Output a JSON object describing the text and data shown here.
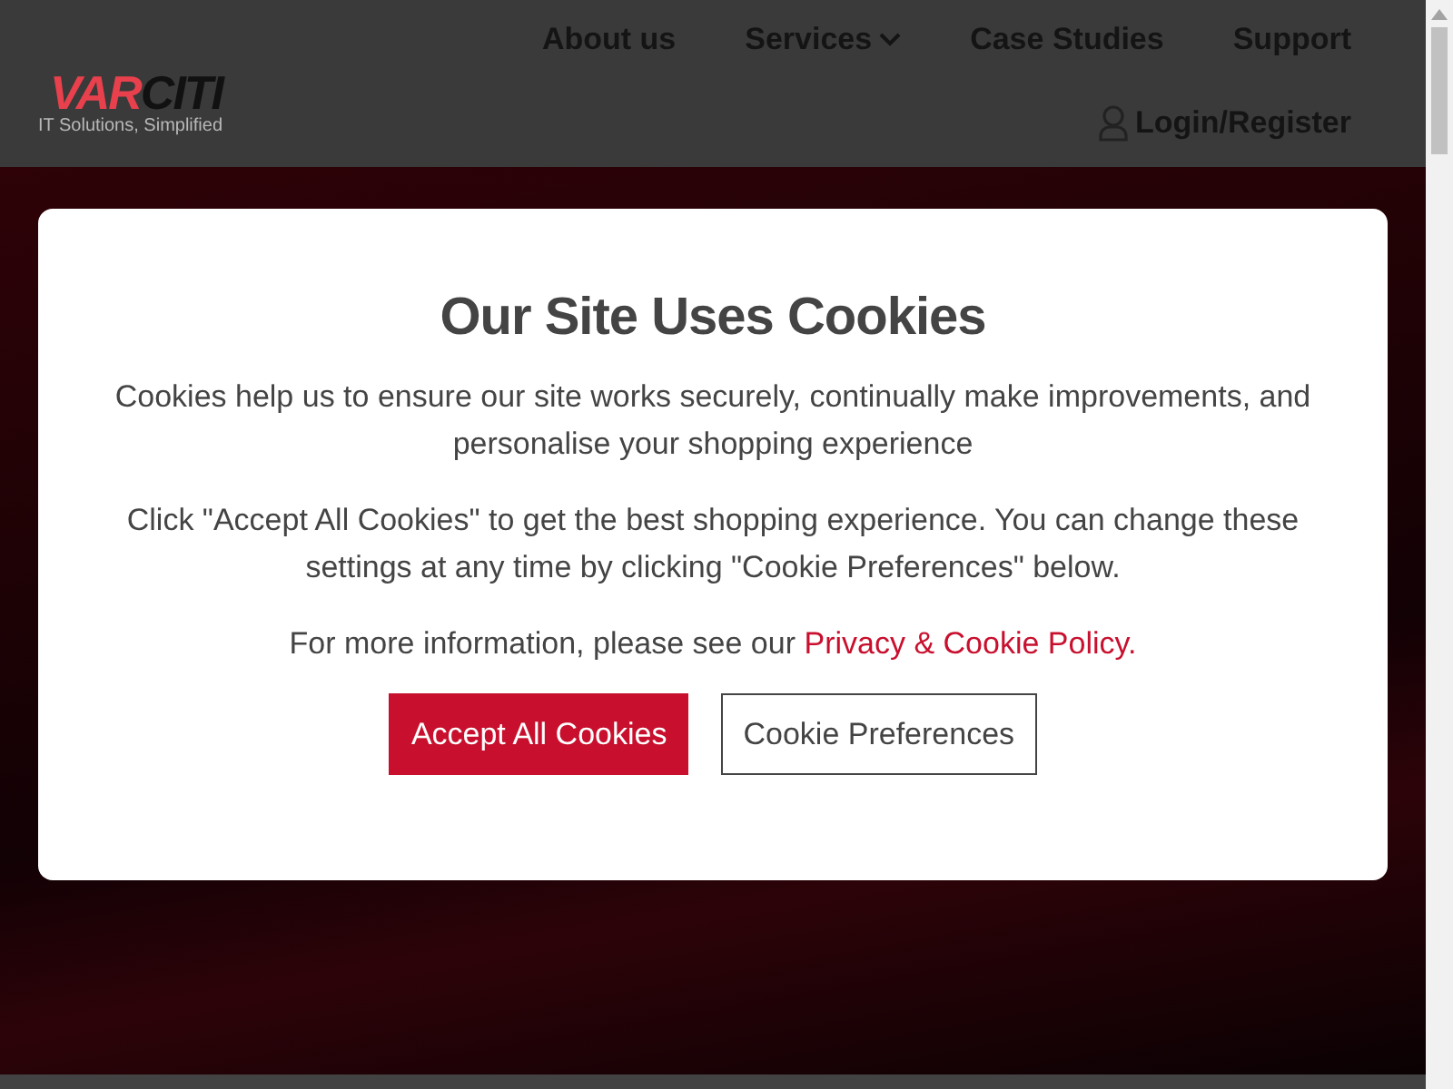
{
  "logo": {
    "parts": [
      {
        "text": "VAR",
        "color": "#e8404c"
      },
      {
        "text": "CITI",
        "color": "#111111"
      }
    ],
    "tagline": "IT Solutions, Simplified"
  },
  "nav": {
    "items": [
      {
        "label": "About us",
        "has_menu": false
      },
      {
        "label": "Services",
        "has_menu": true
      },
      {
        "label": "Case Studies",
        "has_menu": false
      },
      {
        "label": "Support",
        "has_menu": false
      }
    ],
    "account": "Login/Register"
  },
  "cookie_dialog": {
    "title": "Our Site Uses Cookies",
    "paragraphs": [
      "Cookies help us to ensure our site works securely, continually make improvements, and personalise your shopping experience",
      "Click \"Accept All Cookies\" to get the best shopping experience. You can change these settings at any time by clicking \"Cookie Preferences\" below."
    ],
    "info_text": "For more information, please see our",
    "info_link": "Privacy & Cookie Policy.",
    "buttons": [
      {
        "label": "Accept All Cookies",
        "kind": "primary"
      },
      {
        "label": "Cookie Preferences",
        "kind": "outline"
      }
    ]
  }
}
